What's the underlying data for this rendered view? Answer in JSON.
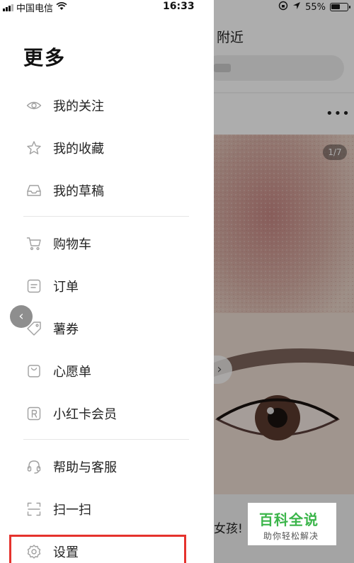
{
  "status_bar": {
    "carrier": "中国电信",
    "time": "16:33",
    "battery": "55%",
    "battery_level": 0.55
  },
  "drawer": {
    "title": "更多",
    "items": [
      {
        "label": "我的关注",
        "icon": "eye-icon"
      },
      {
        "label": "我的收藏",
        "icon": "star-icon"
      },
      {
        "label": "我的草稿",
        "icon": "inbox-icon"
      },
      {
        "label": "购物车",
        "icon": "cart-icon"
      },
      {
        "label": "订单",
        "icon": "order-icon"
      },
      {
        "label": "薯券",
        "icon": "coupon-icon"
      },
      {
        "label": "心愿单",
        "icon": "wishlist-icon"
      },
      {
        "label": "小红卡会员",
        "icon": "membership-icon"
      },
      {
        "label": "帮助与客服",
        "icon": "headset-icon"
      },
      {
        "label": "扫一扫",
        "icon": "scan-icon"
      },
      {
        "label": "设置",
        "icon": "gear-icon"
      }
    ]
  },
  "background_page": {
    "tab_label": "附近",
    "image_counter": "1/7",
    "caption_fragment": "女孩!"
  },
  "watermark": {
    "title": "百科全说",
    "subtitle": "助你轻松解决"
  },
  "colors": {
    "highlight": "#e5322d",
    "watermark_green": "#3bb54a"
  }
}
